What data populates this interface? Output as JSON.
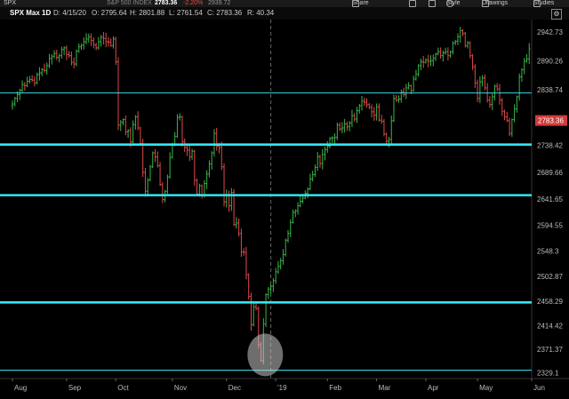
{
  "toolbar": {
    "symbol": "SPX",
    "description": "S&P 500 INDEX",
    "last": "2783.36",
    "change_pct": "-2.20%",
    "change_value": "2939.72",
    "share_label": "Share",
    "style_label": "Style",
    "drawings_label": "Drawings",
    "studies_label": "Studies"
  },
  "infobar": {
    "title": "SPX Max 1D",
    "date": "D: 4/15/20",
    "open": "O: 2795.64",
    "high": "H: 2801.88",
    "low": "L: 2761.54",
    "close": "C: 2783.36",
    "range": "R: 40.34"
  },
  "chart_data": {
    "type": "candlestick",
    "price_axis": {
      "labels": [
        "2942.73",
        "2890.26",
        "2838.74",
        "2783.36",
        "2738.42",
        "2689.66",
        "2641.65",
        "2594.55",
        "2548.3",
        "2502.87",
        "2458.29",
        "2414.42",
        "2371.37",
        "2329.1"
      ],
      "values": [
        2942.73,
        2890.26,
        2838.74,
        2783.36,
        2738.42,
        2689.66,
        2641.65,
        2594.55,
        2548.3,
        2502.87,
        2458.29,
        2414.42,
        2371.37,
        2329.1
      ],
      "ylim": [
        2319,
        2965
      ]
    },
    "last_price": 2783.36,
    "date_axis": {
      "labels": [
        "Aug",
        "Sep",
        "Oct",
        "Nov",
        "Dec",
        "'19",
        "Feb",
        "Mar",
        "Apr",
        "May",
        "Jun"
      ],
      "day_index": [
        0,
        22,
        42,
        65,
        87,
        107,
        128,
        148,
        168,
        189,
        211
      ]
    },
    "vertical_marker_day": 105,
    "horizontal_levels": [
      {
        "price": 2833,
        "weight": "thin"
      },
      {
        "price": 2740,
        "weight": "thick"
      },
      {
        "price": 2649,
        "weight": "thick"
      },
      {
        "price": 2456,
        "weight": "thick"
      },
      {
        "price": 2334,
        "weight": "thin"
      }
    ],
    "highlight": {
      "day": 102,
      "price": 2352
    },
    "closes": [
      2813,
      2823,
      2830,
      2838,
      2848,
      2846,
      2854,
      2857,
      2856,
      2851,
      2866,
      2869,
      2875,
      2873,
      2882,
      2895,
      2899,
      2904,
      2897,
      2900,
      2911,
      2914,
      2902,
      2900,
      2888,
      2885,
      2908,
      2916,
      2919,
      2925,
      2930,
      2934,
      2927,
      2919,
      2914,
      2925,
      2933,
      2931,
      2925,
      2924,
      2918,
      2930,
      2889,
      2775,
      2780,
      2785,
      2763,
      2765,
      2745,
      2776,
      2790,
      2770,
      2742,
      2690,
      2656,
      2676,
      2700,
      2725,
      2718,
      2702,
      2668,
      2641,
      2656,
      2682,
      2717,
      2740,
      2755,
      2789,
      2790,
      2745,
      2735,
      2730,
      2718,
      2728,
      2676,
      2651,
      2666,
      2650,
      2670,
      2687,
      2705,
      2725,
      2760,
      2737,
      2735,
      2700,
      2637,
      2650,
      2630,
      2654,
      2596,
      2599,
      2580,
      2547,
      2546,
      2506,
      2467,
      2416,
      2448,
      2445,
      2380,
      2351,
      2417,
      2470,
      2480,
      2485,
      2495,
      2511,
      2521,
      2531,
      2542,
      2568,
      2580,
      2600,
      2618,
      2621,
      2630,
      2638,
      2644,
      2652,
      2660,
      2678,
      2686,
      2699,
      2718,
      2706,
      2722,
      2731,
      2737,
      2751,
      2752,
      2753,
      2775,
      2768,
      2770,
      2777,
      2772,
      2779,
      2792,
      2786,
      2801,
      2810,
      2818,
      2816,
      2812,
      2807,
      2799,
      2793,
      2808,
      2784,
      2782,
      2759,
      2746,
      2749,
      2783,
      2823,
      2820,
      2822,
      2835,
      2830,
      2842,
      2846,
      2837,
      2858,
      2867,
      2882,
      2889,
      2888,
      2892,
      2890,
      2891,
      2895,
      2903,
      2907,
      2900,
      2905,
      2907,
      2900,
      2907,
      2923,
      2926,
      2934,
      2945,
      2940,
      2918,
      2923,
      2900,
      2880,
      2851,
      2823,
      2853,
      2860,
      2842,
      2820,
      2812,
      2826,
      2845,
      2840,
      2820,
      2800,
      2790,
      2783,
      2760,
      2785,
      2804,
      2826,
      2862,
      2875,
      2890,
      2894,
      2912
    ]
  }
}
